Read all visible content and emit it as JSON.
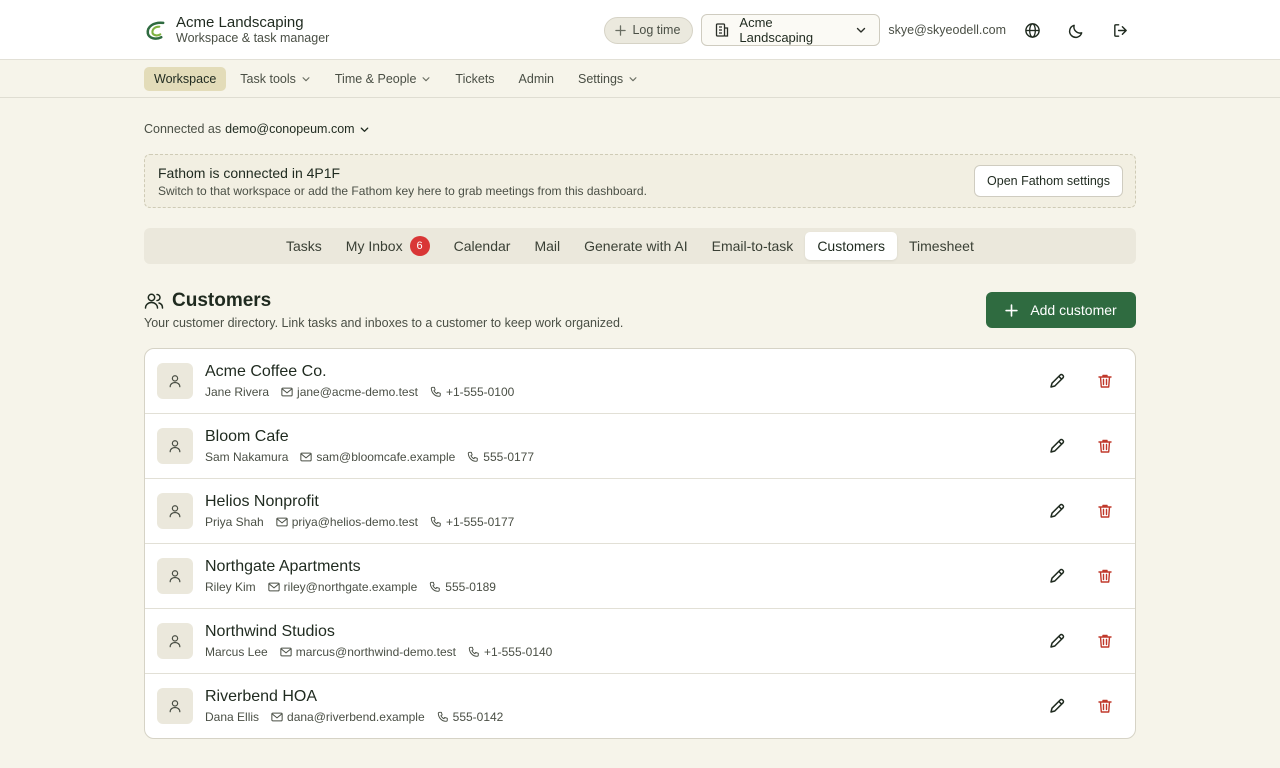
{
  "brand": {
    "name": "Acme Landscaping",
    "subtitle": "Workspace & task manager"
  },
  "header": {
    "log_time_label": "Log time",
    "workspace_select": "Acme Landscaping",
    "user_email": "skye@skyeodell.com"
  },
  "nav": {
    "items": [
      {
        "label": "Workspace",
        "active": true,
        "dropdown": false
      },
      {
        "label": "Task tools",
        "active": false,
        "dropdown": true
      },
      {
        "label": "Time & People",
        "active": false,
        "dropdown": true
      },
      {
        "label": "Tickets",
        "active": false,
        "dropdown": false
      },
      {
        "label": "Admin",
        "active": false,
        "dropdown": false
      },
      {
        "label": "Settings",
        "active": false,
        "dropdown": true
      }
    ]
  },
  "connected": {
    "prefix": "Connected as",
    "account": "demo@conopeum.com"
  },
  "banner": {
    "title": "Fathom is connected in 4P1F",
    "subtitle": "Switch to that workspace or add the Fathom key here to grab meetings from this dashboard.",
    "button_label": "Open Fathom settings"
  },
  "tabs": [
    {
      "label": "Tasks"
    },
    {
      "label": "My Inbox",
      "badge": "6"
    },
    {
      "label": "Calendar"
    },
    {
      "label": "Mail"
    },
    {
      "label": "Generate with AI"
    },
    {
      "label": "Email-to-task"
    },
    {
      "label": "Customers",
      "active": true
    },
    {
      "label": "Timesheet"
    }
  ],
  "section": {
    "title": "Customers",
    "subtitle": "Your customer directory. Link tasks and inboxes to a customer to keep work organized.",
    "add_button_label": "Add customer"
  },
  "customers": [
    {
      "name": "Acme Coffee Co.",
      "contact": "Jane Rivera",
      "email": "jane@acme-demo.test",
      "phone": "+1-555-0100"
    },
    {
      "name": "Bloom Cafe",
      "contact": "Sam Nakamura",
      "email": "sam@bloomcafe.example",
      "phone": "555-0177"
    },
    {
      "name": "Helios Nonprofit",
      "contact": "Priya Shah",
      "email": "priya@helios-demo.test",
      "phone": "+1-555-0177"
    },
    {
      "name": "Northgate Apartments",
      "contact": "Riley Kim",
      "email": "riley@northgate.example",
      "phone": "555-0189"
    },
    {
      "name": "Northwind Studios",
      "contact": "Marcus Lee",
      "email": "marcus@northwind-demo.test",
      "phone": "+1-555-0140"
    },
    {
      "name": "Riverbend HOA",
      "contact": "Dana Ellis",
      "email": "dana@riverbend.example",
      "phone": "555-0142"
    }
  ],
  "colors": {
    "page_bg": "#f6f4ea",
    "accent_green": "#2f6b40",
    "danger_red": "#c0392b",
    "badge_red": "#d93636",
    "active_nav": "#e3dcb9"
  },
  "icons": {
    "brand": "leaf-logo-icon",
    "log_time": "plus-icon",
    "workspace": "building-icon",
    "language": "globe-icon",
    "theme": "moon-icon",
    "logout": "logout-icon",
    "customers": "users-icon",
    "add": "plus-icon",
    "avatar": "user-icon",
    "email": "mail-icon",
    "phone": "phone-icon",
    "edit": "pencil-icon",
    "delete": "trash-icon"
  }
}
